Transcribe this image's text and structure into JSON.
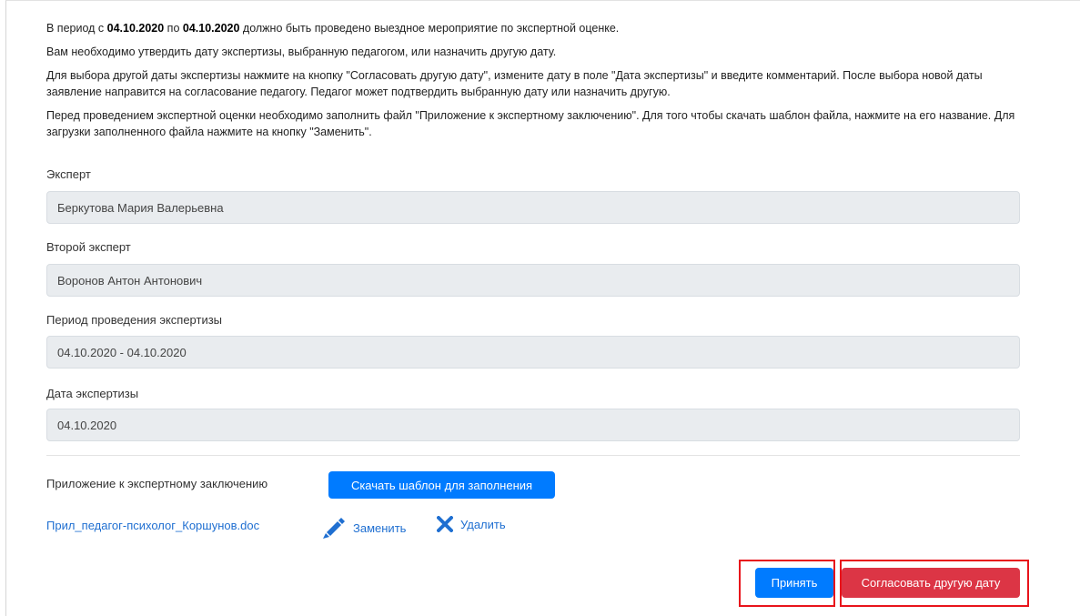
{
  "intro": {
    "p1_prefix": "В период с ",
    "date_from": "04.10.2020",
    "p1_mid": " по ",
    "date_to": "04.10.2020",
    "p1_suffix": " должно быть проведено выездное мероприятие по экспертной оценке.",
    "p2": "Вам необходимо утвердить дату экспертизы, выбранную педагогом, или назначить другую дату.",
    "p3": "Для выбора другой даты экспертизы нажмите на кнопку \"Согласовать другую дату\", измените дату в поле \"Дата экспертизы\" и введите комментарий. После выбора новой даты заявление направится на согласование педагогу. Педагог может подтвердить выбранную дату или назначить другую.",
    "p4": "Перед проведением экспертной оценки необходимо заполнить файл \"Приложение к экспертному заключению\". Для того чтобы скачать шаблон файла, нажмите на его название. Для загрузки заполненного файла нажмите на кнопку \"Заменить\"."
  },
  "form": {
    "expert_label": "Эксперт",
    "expert_value": "Беркутова Мария Валерьевна",
    "second_expert_label": "Второй эксперт",
    "second_expert_value": "Воронов Антон Антонович",
    "period_label": "Период проведения экспертизы",
    "period_value": "04.10.2020 - 04.10.2020",
    "date_label": "Дата экспертизы",
    "date_value": "04.10.2020"
  },
  "attachment": {
    "label": "Приложение к экспертному заключению",
    "download_button": "Скачать шаблон для заполнения",
    "file_name": "Прил_педагог-психолог_Коршунов.doc",
    "replace_label": "Заменить",
    "delete_label": "Удалить"
  },
  "actions": {
    "accept_button": "Принять",
    "other_date_button": "Согласовать другую дату"
  },
  "colors": {
    "primary": "#007bff",
    "danger": "#dc3545",
    "highlight": "#e8141b",
    "link": "#1f6fd1"
  },
  "icons": [
    "pencil-icon",
    "close-icon"
  ]
}
